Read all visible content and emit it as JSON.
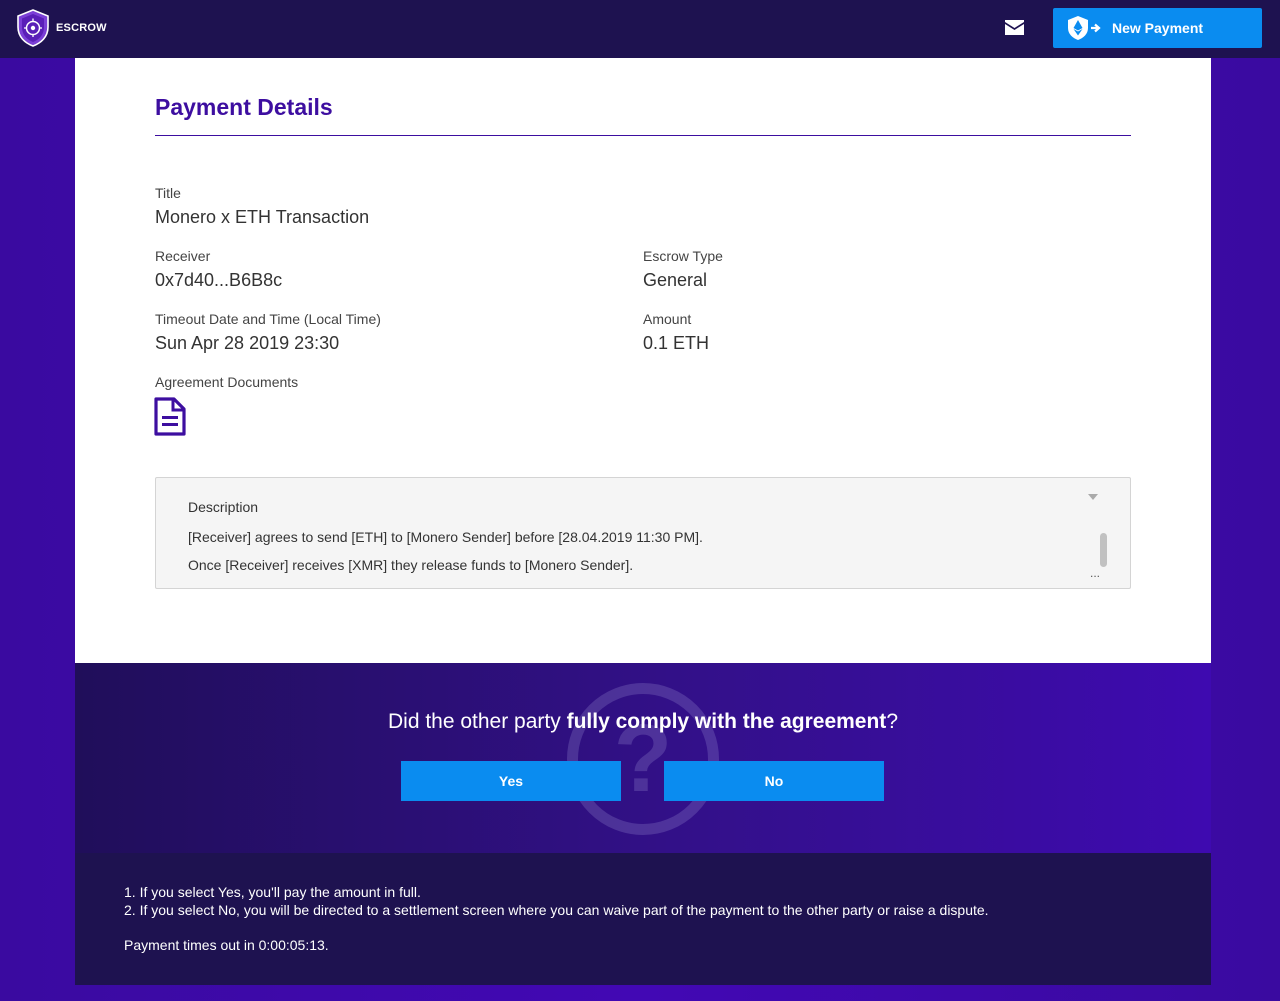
{
  "header": {
    "logo_text": "ESCROW",
    "new_payment_label": "New Payment"
  },
  "page": {
    "title": "Payment Details"
  },
  "fields": {
    "title": {
      "label": "Title",
      "value": "Monero x ETH Transaction"
    },
    "receiver": {
      "label": "Receiver",
      "value": "0x7d40...B6B8c"
    },
    "escrow_type": {
      "label": "Escrow Type",
      "value": "General"
    },
    "timeout": {
      "label": "Timeout Date and Time (Local Time)",
      "value": "Sun Apr 28 2019 23:30"
    },
    "amount": {
      "label": "Amount",
      "value": "0.1 ETH"
    },
    "documents": {
      "label": "Agreement Documents"
    }
  },
  "description": {
    "heading": "Description",
    "lines": [
      "[Receiver] agrees to send [ETH] to [Monero Sender] before [28.04.2019 11:30 PM].",
      "Once [Receiver] receives [XMR] they release funds to [Monero Sender]."
    ],
    "ellipsis": "..."
  },
  "question": {
    "prefix": "Did the other party ",
    "emphasis": "fully comply with the agreement",
    "suffix": "?",
    "yes_label": "Yes",
    "no_label": "No",
    "bg_glyph": "?"
  },
  "info": {
    "notes": [
      "1. If you select Yes, you'll pay the amount in full.",
      "2. If you select No, you will be directed to a settlement screen where you can waive part of the payment to the other party or raise a dispute."
    ],
    "timeout_text": "Payment times out in 0:00:05:13."
  },
  "colors": {
    "accent_blue": "#0a8cf0",
    "brand_purple": "#3d0ea0",
    "header_bg": "#1e1250"
  }
}
